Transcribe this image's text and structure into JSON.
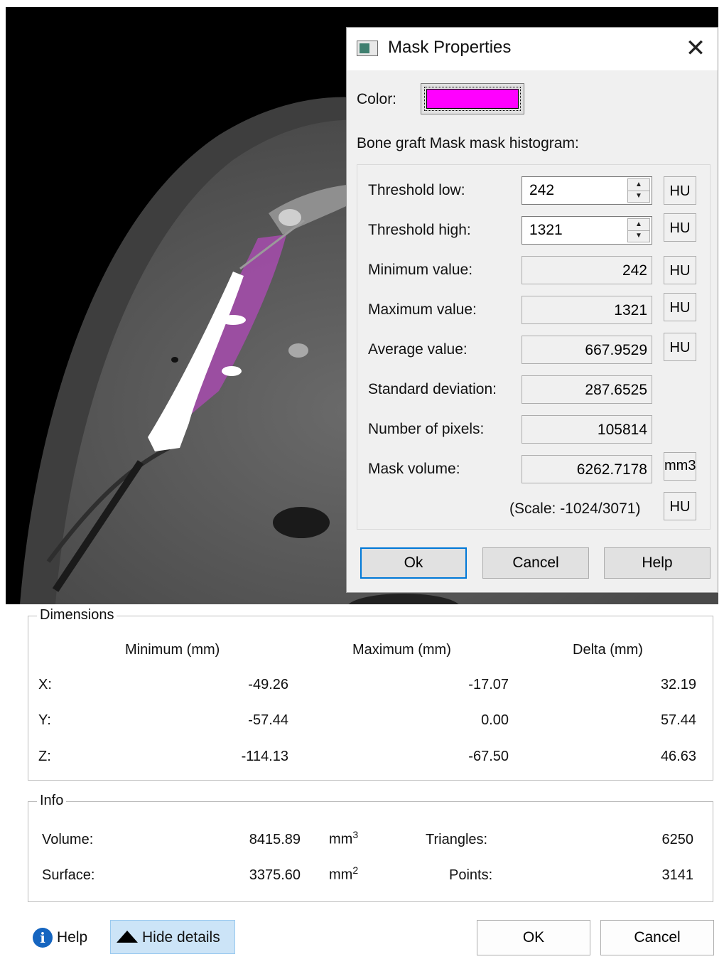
{
  "mask_dialog": {
    "title": "Mask Properties",
    "close_glyph": "✕",
    "color_label": "Color:",
    "mask_color": "#ff00ff",
    "histogram_label": "Bone graft Mask mask histogram:",
    "rows": {
      "threshold_low": {
        "label": "Threshold low:",
        "value": "242",
        "unit": "HU"
      },
      "threshold_high": {
        "label": "Threshold high:",
        "value": "1321",
        "unit": "HU"
      },
      "minimum": {
        "label": "Minimum value:",
        "value": "242",
        "unit": "HU"
      },
      "maximum": {
        "label": "Maximum value:",
        "value": "1321",
        "unit": "HU"
      },
      "average": {
        "label": "Average value:",
        "value": "667.9529",
        "unit": "HU"
      },
      "std_dev": {
        "label": "Standard deviation:",
        "value": "287.6525"
      },
      "pixels": {
        "label": "Number of pixels:",
        "value": "105814"
      },
      "volume": {
        "label": "Mask volume:",
        "value": "6262.7178",
        "unit": "mm3"
      }
    },
    "scale_text": "(Scale: -1024/3071)",
    "scale_unit": "HU",
    "buttons": {
      "ok": "Ok",
      "cancel": "Cancel",
      "help": "Help"
    }
  },
  "dimensions": {
    "title": "Dimensions",
    "headers": {
      "min": "Minimum (mm)",
      "max": "Maximum (mm)",
      "delta": "Delta (mm)"
    },
    "rows": [
      {
        "axis": "X:",
        "min": "-49.26",
        "max": "-17.07",
        "delta": "32.19"
      },
      {
        "axis": "Y:",
        "min": "-57.44",
        "max": "0.00",
        "delta": "57.44"
      },
      {
        "axis": "Z:",
        "min": "-114.13",
        "max": "-67.50",
        "delta": "46.63"
      }
    ]
  },
  "info": {
    "title": "Info",
    "volume_label": "Volume:",
    "volume_value": "8415.89",
    "volume_unit": "mm",
    "volume_exp": "3",
    "surface_label": "Surface:",
    "surface_value": "3375.60",
    "surface_unit": "mm",
    "surface_exp": "2",
    "triangles_label": "Triangles:",
    "triangles_value": "6250",
    "points_label": "Points:",
    "points_value": "3141"
  },
  "footer": {
    "help_icon_glyph": "i",
    "help_label": "Help",
    "hide_details_label": "Hide details",
    "ok_label": "OK",
    "cancel_label": "Cancel"
  }
}
